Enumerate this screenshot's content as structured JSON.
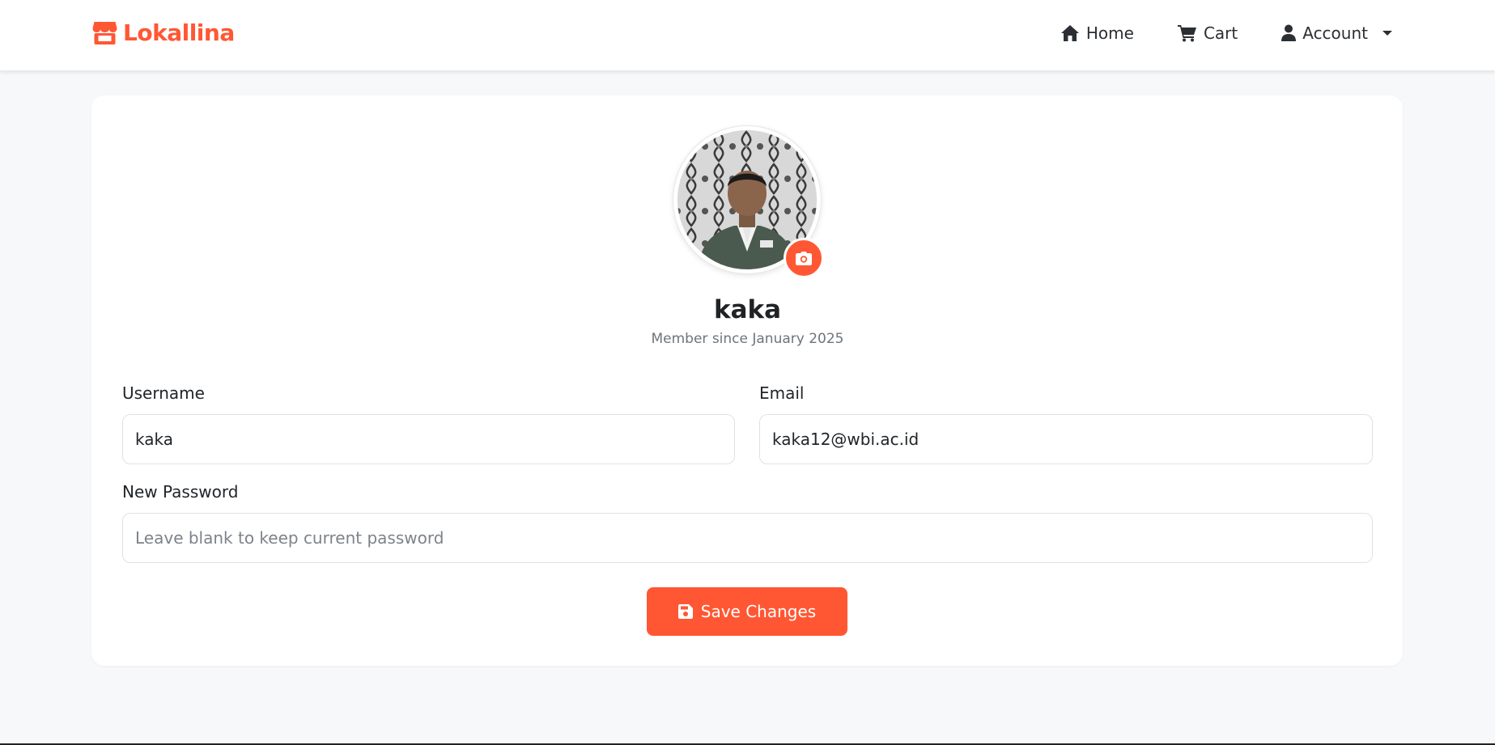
{
  "brand": {
    "name": "Lokallina",
    "icon": "store-icon",
    "color": "#ff5733"
  },
  "nav": {
    "home_label": "Home",
    "cart_label": "Cart",
    "account_label": "Account"
  },
  "profile": {
    "name": "kaka",
    "member_since": "Member since January 2025",
    "avatar_icon": "user-photo",
    "camera_icon": "camera-icon"
  },
  "form": {
    "username_label": "Username",
    "username_value": "kaka",
    "email_label": "Email",
    "email_value": "kaka12@wbi.ac.id",
    "password_label": "New Password",
    "password_placeholder": "Leave blank to keep current password",
    "save_label": "Save Changes"
  },
  "colors": {
    "accent": "#ff5733",
    "background": "#f7f8fa",
    "card": "#ffffff"
  }
}
